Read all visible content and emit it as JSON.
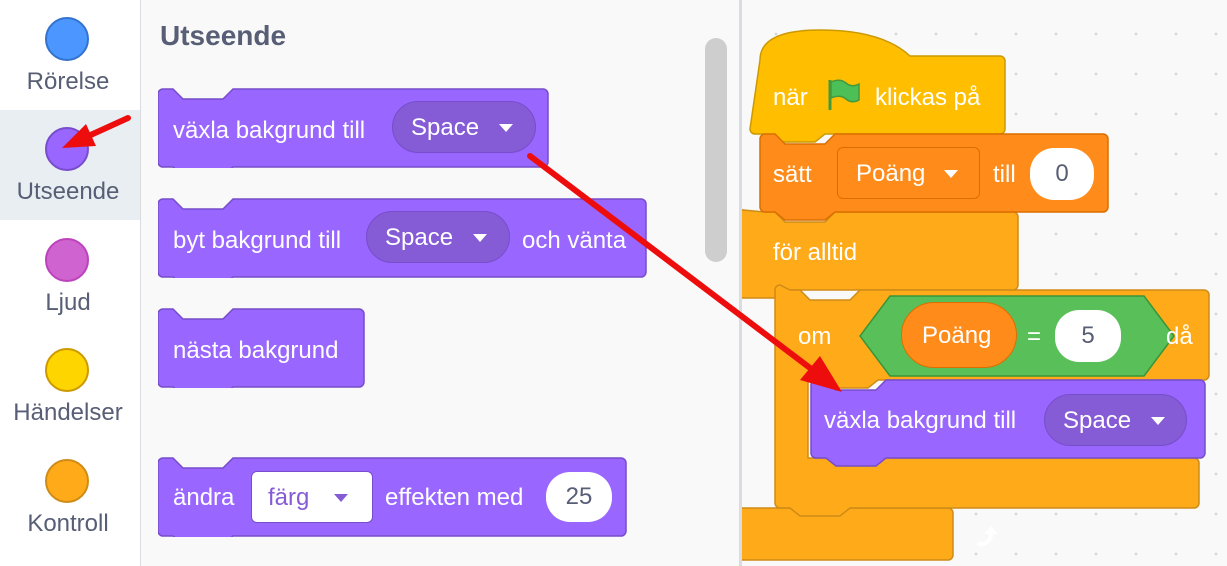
{
  "categories": [
    {
      "label": "Rörelse",
      "color": "#4c97ff",
      "border": "#3373cc"
    },
    {
      "label": "Utseende",
      "color": "#9966ff",
      "border": "#774dcb"
    },
    {
      "label": "Ljud",
      "color": "#cf63cf",
      "border": "#bd42bd"
    },
    {
      "label": "Händelser",
      "color": "#ffd500",
      "border": "#cc9900"
    },
    {
      "label": "Kontroll",
      "color": "#ffab19",
      "border": "#cf8b17"
    }
  ],
  "palette": {
    "title": "Utseende",
    "switch_backdrop": {
      "label": "växla bakgrund till",
      "dropdown": "Space"
    },
    "switch_backdrop_wait": {
      "label": "byt bakgrund till",
      "dropdown": "Space",
      "suffix": "och vänta"
    },
    "next_backdrop": {
      "label": "nästa bakgrund"
    },
    "change_effect": {
      "label": "ändra",
      "dropdown": "färg",
      "middle": "effekten med",
      "value": "25"
    }
  },
  "script": {
    "hat": {
      "before": "när",
      "after": "klickas på",
      "icon": "green-flag-icon"
    },
    "set_var": {
      "label": "sätt",
      "variable": "Poäng",
      "to": "till",
      "value": "0"
    },
    "forever": {
      "label": "för alltid",
      "icon": "loop-arrow-icon"
    },
    "if": {
      "label": "om",
      "then": "då",
      "reporter": "Poäng",
      "operator": "=",
      "value": "5"
    },
    "inner": {
      "label": "växla bakgrund till",
      "dropdown": "Space"
    }
  },
  "colors": {
    "looks": "#9966ff",
    "looks_dark": "#774dcb",
    "events": "#ffbf00",
    "variables": "#ff8c1a",
    "control": "#ffab19",
    "operators": "#59c059",
    "annotation": "#ee0d0d"
  }
}
